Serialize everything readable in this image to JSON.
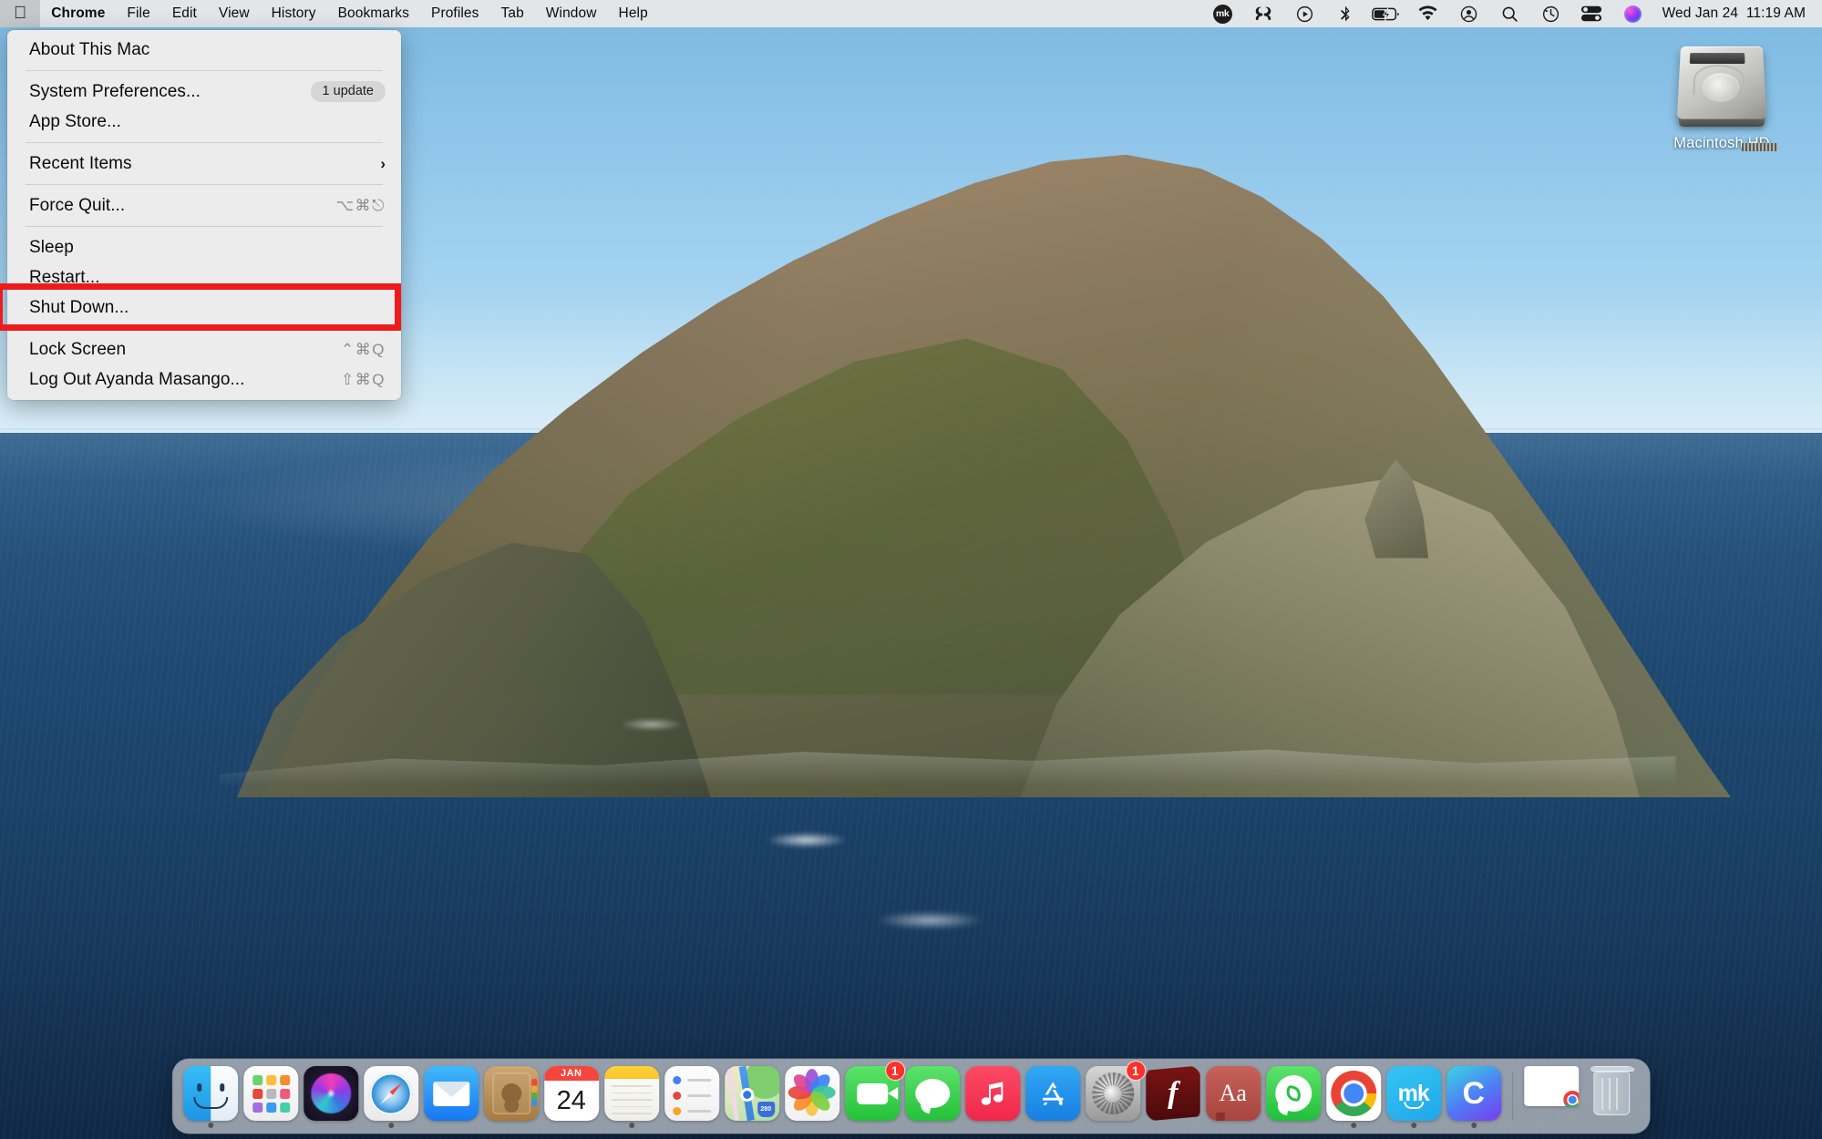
{
  "menubar": {
    "apple_icon": "apple-logo-icon",
    "items": [
      "Chrome",
      "File",
      "Edit",
      "View",
      "History",
      "Bookmarks",
      "Profiles",
      "Tab",
      "Window",
      "Help"
    ],
    "status_icons": [
      {
        "name": "mk-menu-extra-icon",
        "glyph": "mk"
      },
      {
        "name": "adobe-creative-cloud-icon",
        "glyph": "♾"
      },
      {
        "name": "screen-record-icon",
        "glyph": "▶"
      },
      {
        "name": "bluetooth-icon",
        "glyph": "ᛦ"
      },
      {
        "name": "battery-charging-icon",
        "glyph": "⚡"
      },
      {
        "name": "wifi-icon",
        "glyph": "◠"
      },
      {
        "name": "user-account-icon",
        "glyph": "◉"
      },
      {
        "name": "spotlight-search-icon",
        "glyph": "⌕"
      },
      {
        "name": "time-machine-icon",
        "glyph": "↺"
      },
      {
        "name": "control-center-icon",
        "glyph": "≡"
      },
      {
        "name": "siri-icon",
        "glyph": ""
      }
    ],
    "clock": "Wed Jan 24  11:19 AM"
  },
  "apple_menu": {
    "rows": [
      {
        "label": "About This Mac",
        "shortcut": "",
        "badge": "",
        "chevron": false
      },
      {
        "sep": true
      },
      {
        "label": "System Preferences...",
        "shortcut": "",
        "badge": "1 update",
        "chevron": false
      },
      {
        "label": "App Store...",
        "shortcut": "",
        "badge": "",
        "chevron": false
      },
      {
        "sep": true
      },
      {
        "label": "Recent Items",
        "shortcut": "",
        "badge": "",
        "chevron": true
      },
      {
        "sep": true
      },
      {
        "label": "Force Quit...",
        "shortcut": "⌥⌘⎋",
        "badge": "",
        "chevron": false
      },
      {
        "sep": true
      },
      {
        "label": "Sleep",
        "shortcut": "",
        "badge": "",
        "chevron": false
      },
      {
        "label": "Restart...",
        "shortcut": "",
        "badge": "",
        "chevron": false
      },
      {
        "label": "Shut Down...",
        "shortcut": "",
        "badge": "",
        "chevron": false
      },
      {
        "sep": true
      },
      {
        "label": "Lock Screen",
        "shortcut": "⌃⌘Q",
        "badge": "",
        "chevron": false
      },
      {
        "label": "Log Out Ayanda Masango...",
        "shortcut": "⇧⌘Q",
        "badge": "",
        "chevron": false
      }
    ]
  },
  "annotation": {
    "target_label": "Restart...",
    "color": "#ee1b1b"
  },
  "desktop": {
    "icons": [
      {
        "name": "macintosh-hd",
        "label": "Macintosh HD"
      }
    ]
  },
  "dock": {
    "items": [
      {
        "name": "finder",
        "label": "Finder",
        "running": true,
        "badge": ""
      },
      {
        "name": "launchpad",
        "label": "Launchpad",
        "running": false,
        "badge": ""
      },
      {
        "name": "siri",
        "label": "Siri",
        "running": false,
        "badge": ""
      },
      {
        "name": "safari",
        "label": "Safari",
        "running": true,
        "badge": ""
      },
      {
        "name": "mail",
        "label": "Mail",
        "running": false,
        "badge": ""
      },
      {
        "name": "contacts",
        "label": "Contacts",
        "running": false,
        "badge": ""
      },
      {
        "name": "calendar",
        "label": "Calendar",
        "running": false,
        "badge": "",
        "month": "JAN",
        "day": "24"
      },
      {
        "name": "notes",
        "label": "Notes",
        "running": true,
        "badge": ""
      },
      {
        "name": "reminders",
        "label": "Reminders",
        "running": false,
        "badge": ""
      },
      {
        "name": "maps",
        "label": "Maps",
        "running": false,
        "badge": "",
        "shield": "280"
      },
      {
        "name": "photos",
        "label": "Photos",
        "running": false,
        "badge": ""
      },
      {
        "name": "facetime",
        "label": "FaceTime",
        "running": false,
        "badge": "1"
      },
      {
        "name": "messages",
        "label": "Messages",
        "running": false,
        "badge": ""
      },
      {
        "name": "music",
        "label": "Music",
        "running": false,
        "badge": ""
      },
      {
        "name": "app-store",
        "label": "App Store",
        "running": false,
        "badge": ""
      },
      {
        "name": "system-preferences",
        "label": "System Preferences",
        "running": false,
        "badge": "1"
      },
      {
        "name": "flash-player",
        "label": "Flash Player",
        "running": false,
        "badge": ""
      },
      {
        "name": "dictionary",
        "label": "Dictionary",
        "running": false,
        "badge": "",
        "glyph": "Aa"
      },
      {
        "name": "whatsapp",
        "label": "WhatsApp",
        "running": false,
        "badge": ""
      },
      {
        "name": "chrome",
        "label": "Google Chrome",
        "running": true,
        "badge": ""
      },
      {
        "name": "mk-app",
        "label": "mk",
        "running": true,
        "badge": "",
        "glyph": "mk"
      },
      {
        "name": "c-app",
        "label": "C",
        "running": true,
        "badge": "",
        "glyph": "C"
      },
      {
        "name": "minimized-window",
        "label": "Minimized Chrome Window",
        "running": false,
        "badge": ""
      },
      {
        "name": "trash",
        "label": "Trash",
        "running": false,
        "badge": ""
      }
    ]
  }
}
